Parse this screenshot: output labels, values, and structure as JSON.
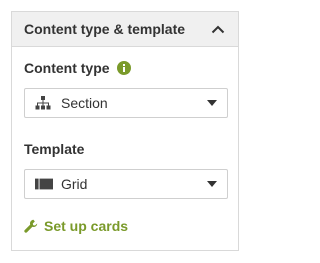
{
  "panel": {
    "title": "Content type & template"
  },
  "content_type": {
    "label": "Content type",
    "value": "Section",
    "icon": "sitemap-icon"
  },
  "template": {
    "label": "Template",
    "value": "Grid",
    "icon": "grid-layout-icon"
  },
  "actions": {
    "setup_cards": "Set up cards"
  },
  "colors": {
    "accent": "#7a9a2a",
    "header_bg": "#f0f0f0",
    "border": "#d9d9d9"
  }
}
